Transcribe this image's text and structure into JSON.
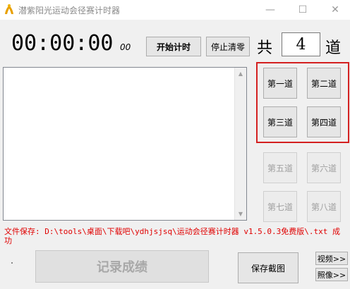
{
  "window": {
    "title": "潜紫阳光运动会径赛计时器",
    "minimize_icon": "—",
    "maximize_icon": "☐",
    "close_icon": "✕"
  },
  "timer": {
    "main": "00:00:00",
    "fraction": "00"
  },
  "controls": {
    "start_label": "开始计时",
    "stop_label": "停止清零",
    "total_label": "共",
    "lane_count": "4",
    "lane_unit": "道"
  },
  "lanes": [
    {
      "label": "第一道",
      "enabled": true
    },
    {
      "label": "第二道",
      "enabled": true
    },
    {
      "label": "第三道",
      "enabled": true
    },
    {
      "label": "第四道",
      "enabled": true
    },
    {
      "label": "第五道",
      "enabled": false
    },
    {
      "label": "第六道",
      "enabled": false
    },
    {
      "label": "第七道",
      "enabled": false
    },
    {
      "label": "第八道",
      "enabled": false
    }
  ],
  "save_path": "文件保存: D:\\tools\\桌面\\下载吧\\ydhjsjsq\\运动会径赛计时器 v1.5.0.3免费版\\.txt 成功",
  "bottom": {
    "record_label": "记录成绩",
    "screenshot_label": "保存截图",
    "video_label": "视频>>",
    "photo_label": "照像>>"
  },
  "colors": {
    "highlight": "#d42020",
    "save_path_text": "#e00000",
    "title_text": "#8a8a8a"
  }
}
